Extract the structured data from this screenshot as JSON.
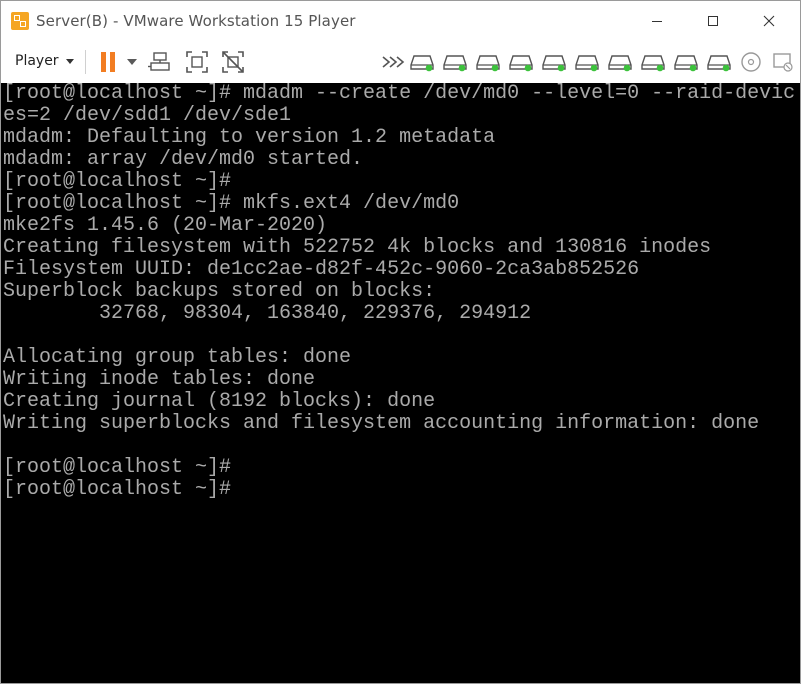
{
  "window": {
    "title": "Server(B) - VMware Workstation 15 Player"
  },
  "toolbar": {
    "player_label": "Player",
    "devices": [
      "hard-disk-1",
      "hard-disk-2",
      "hard-disk-3",
      "hard-disk-4",
      "hard-disk-5",
      "hard-disk-6",
      "hard-disk-7",
      "hard-disk-8",
      "hard-disk-9",
      "hard-disk-10"
    ]
  },
  "colors": {
    "pause_orange": "#f27d22",
    "device_green": "#3cc23c",
    "console_bg": "#000000",
    "console_fg": "#aaaaaa"
  },
  "console": {
    "lines": [
      "[root@localhost ~]# mdadm --create /dev/md0 --level=0 --raid-devic",
      "es=2 /dev/sdd1 /dev/sde1",
      "mdadm: Defaulting to version 1.2 metadata",
      "mdadm: array /dev/md0 started.",
      "[root@localhost ~]#",
      "[root@localhost ~]# mkfs.ext4 /dev/md0",
      "mke2fs 1.45.6 (20-Mar-2020)",
      "Creating filesystem with 522752 4k blocks and 130816 inodes",
      "Filesystem UUID: de1cc2ae-d82f-452c-9060-2ca3ab852526",
      "Superblock backups stored on blocks:",
      "        32768, 98304, 163840, 229376, 294912",
      "",
      "Allocating group tables: done",
      "Writing inode tables: done",
      "Creating journal (8192 blocks): done",
      "Writing superblocks and filesystem accounting information: done",
      "",
      "[root@localhost ~]#",
      "[root@localhost ~]#"
    ]
  }
}
